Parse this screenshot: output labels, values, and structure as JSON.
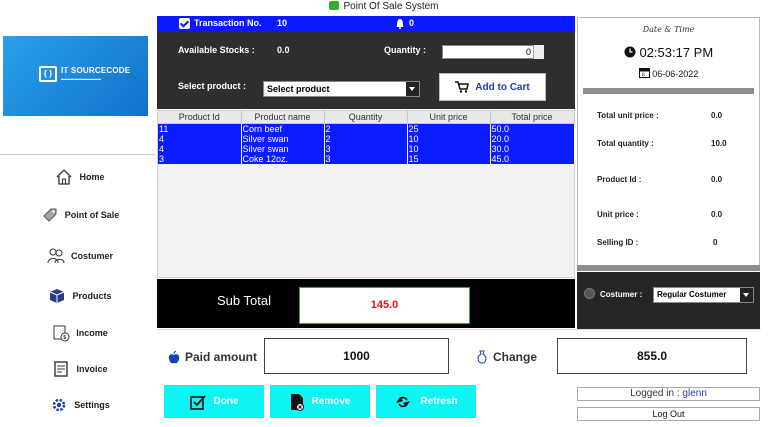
{
  "window": {
    "title": "Point Of Sale System"
  },
  "logo": {
    "brand": "IT SOURCECODE"
  },
  "sidebar": {
    "items": [
      {
        "label": "Home",
        "icon": "home-icon"
      },
      {
        "label": "Point of Sale",
        "icon": "tag-icon"
      },
      {
        "label": "Costumer",
        "icon": "users-icon"
      },
      {
        "label": "Products",
        "icon": "box-icon"
      },
      {
        "label": "Income",
        "icon": "income-icon"
      },
      {
        "label": "Invoice",
        "icon": "invoice-icon"
      },
      {
        "label": "Settings",
        "icon": "gear-icon"
      }
    ]
  },
  "transaction": {
    "label": "Transaction No.",
    "value": "10",
    "notif_count": "0"
  },
  "stock": {
    "label": "Available Stocks :",
    "value": "0.0"
  },
  "quantity": {
    "label": "Quantity :",
    "value": "0"
  },
  "product": {
    "label": "Select product :",
    "selected": "Select product"
  },
  "add_cart": {
    "label": "Add to Cart"
  },
  "table": {
    "headers": [
      "Product Id",
      "Product name",
      "Quantity",
      "Unit price",
      "Total price"
    ],
    "rows": [
      [
        "11",
        "Corn beef",
        "2",
        "25",
        "50.0"
      ],
      [
        "4",
        "Silver swan",
        "2",
        "10",
        "20.0"
      ],
      [
        "4",
        "Silver swan",
        "3",
        "10",
        "30.0"
      ],
      [
        "3",
        "Coke 12oz.",
        "3",
        "15",
        "45.0"
      ]
    ]
  },
  "subtotal": {
    "label": "Sub Total",
    "value": "145.0"
  },
  "paid": {
    "label": "Paid amount",
    "value": "1000"
  },
  "change": {
    "label": "Change",
    "value": "855.0"
  },
  "actions": {
    "done": "Done",
    "remove": "Remove",
    "refresh": "Refresh"
  },
  "datetime": {
    "title": "Date & Time",
    "time": "02:53:17 PM",
    "date": "06-06-2022"
  },
  "summary": {
    "total_unit_price": {
      "label": "Total unit price :",
      "value": "0.0"
    },
    "total_quantity": {
      "label": "Total quantity :",
      "value": "10.0"
    },
    "product_id": {
      "label": "Product Id :",
      "value": "0.0"
    },
    "unit_price": {
      "label": "Unit price :",
      "value": "0.0"
    },
    "selling_id": {
      "label": "Selling ID :",
      "value": "0"
    }
  },
  "customer": {
    "label": "Costumer :",
    "selected": "Regular Costumer"
  },
  "session": {
    "logged_label": "Logged in :",
    "user": "glenn",
    "logout": "Log Out"
  },
  "colors": {
    "accent_blue": "#0a1aff",
    "action_cyan": "#0ef4f4",
    "subtotal_red": "#d8151d"
  }
}
